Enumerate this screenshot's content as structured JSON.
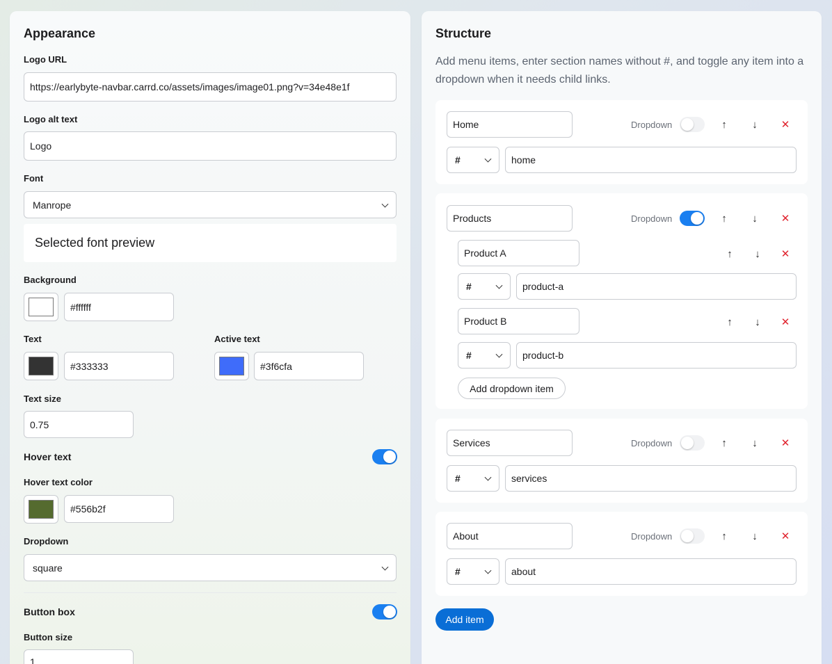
{
  "appearance": {
    "title": "Appearance",
    "logo_url_label": "Logo URL",
    "logo_url_value": "https://earlybyte-navbar.carrd.co/assets/images/image01.png?v=34e48e1f",
    "logo_alt_label": "Logo alt text",
    "logo_alt_value": "Logo",
    "font_label": "Font",
    "font_value": "Manrope",
    "font_preview": "Selected font preview",
    "background_label": "Background",
    "background_value": "#ffffff",
    "background_color": "#ffffff",
    "text_label": "Text",
    "text_value": "#333333",
    "text_color": "#333333",
    "active_text_label": "Active text",
    "active_text_value": "#3f6cfa",
    "active_text_color": "#3f6cfa",
    "text_size_label": "Text size",
    "text_size_value": "0.75",
    "hover_text_label": "Hover text",
    "hover_text_enabled": true,
    "hover_color_label": "Hover text color",
    "hover_color_value": "#556b2f",
    "hover_color": "#556b2f",
    "dropdown_label": "Dropdown",
    "dropdown_value": "square",
    "button_box_label": "Button box",
    "button_box_enabled": true,
    "button_size_label": "Button size",
    "button_size_value": "1"
  },
  "structure": {
    "title": "Structure",
    "description": "Add menu items, enter section names without #, and toggle any item into a dropdown when it needs child links.",
    "dropdown_toggle_label": "Dropdown",
    "hash_symbol": "#",
    "up_icon": "arrow-up-icon",
    "down_icon": "arrow-down-icon",
    "delete_icon": "close-icon",
    "items": [
      {
        "name": "Home",
        "section": "home",
        "dropdown": false
      },
      {
        "name": "Products",
        "section": "",
        "dropdown": true,
        "children": [
          {
            "name": "Product A",
            "section": "product-a"
          },
          {
            "name": "Product B",
            "section": "product-b"
          }
        ],
        "add_child_label": "Add dropdown item"
      },
      {
        "name": "Services",
        "section": "services",
        "dropdown": false
      },
      {
        "name": "About",
        "section": "about",
        "dropdown": false
      }
    ],
    "add_item_label": "Add item"
  },
  "colors": {
    "accent": "#0a6ed6",
    "toggle_on": "#1a7ff0",
    "delete": "#e0242f"
  }
}
